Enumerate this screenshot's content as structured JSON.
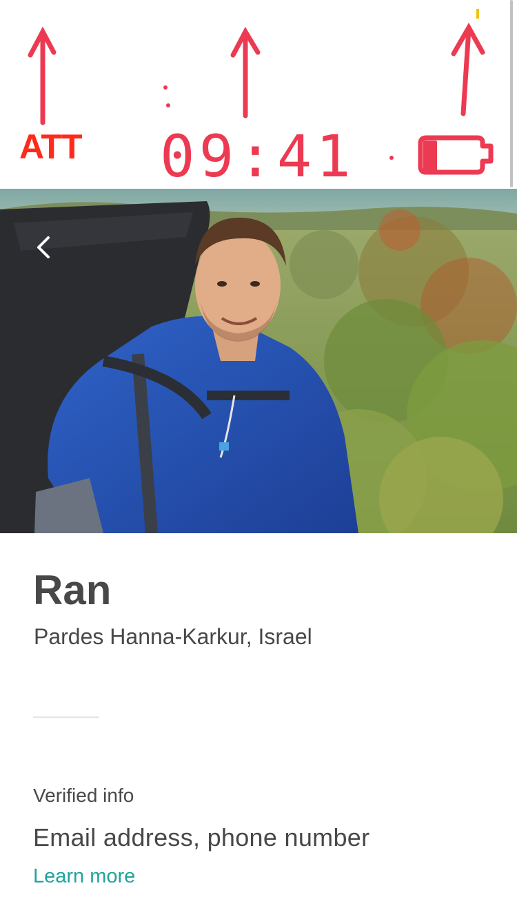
{
  "status_bar": {
    "carrier": "ATT",
    "time": "09:41"
  },
  "hero": {
    "back_icon": "chevron-left-icon"
  },
  "profile": {
    "name": "Ran",
    "location": "Pardes Hanna-Karkur, Israel"
  },
  "verified": {
    "label": "Verified info",
    "value": "Email address, phone number",
    "learn_more": "Learn more"
  },
  "colors": {
    "annotation_red": "#ec3a52",
    "text_dark": "#484848",
    "link_teal": "#1fa39a"
  }
}
